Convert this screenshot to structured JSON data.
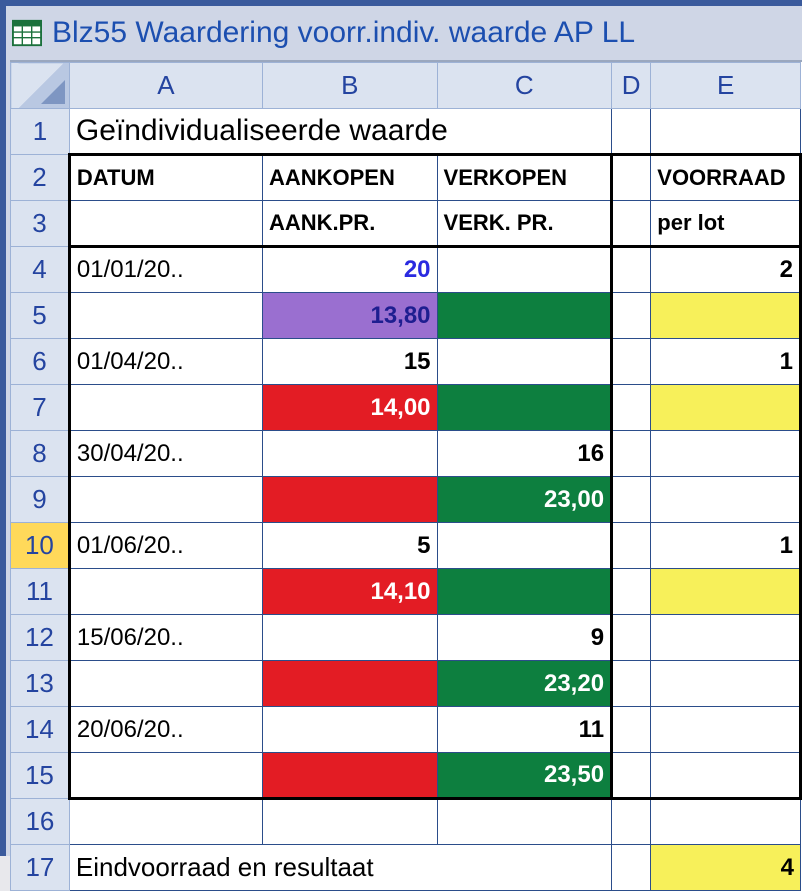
{
  "window": {
    "title": "Blz55 Waardering voorr.indiv. waarde AP LL"
  },
  "columns": [
    "A",
    "B",
    "C",
    "D",
    "E"
  ],
  "rowNumbers": [
    "1",
    "2",
    "3",
    "4",
    "5",
    "6",
    "7",
    "8",
    "9",
    "10",
    "11",
    "12",
    "13",
    "14",
    "15",
    "16",
    "17"
  ],
  "selectedRow": "10",
  "r1": {
    "title": "Geïndividualiseerde waarde"
  },
  "r2": {
    "a": "DATUM",
    "b": "AANKOPEN",
    "c": "VERKOPEN",
    "e": "VOORRAAD"
  },
  "r3": {
    "b": "AANK.PR.",
    "c": "VERK. PR.",
    "e": "per lot"
  },
  "r4": {
    "a": "01/01/20..",
    "b": "20",
    "e": "2"
  },
  "r5": {
    "b": "13,80"
  },
  "r6": {
    "a": "01/04/20..",
    "b": "15",
    "e": "1"
  },
  "r7": {
    "b": "14,00"
  },
  "r8": {
    "a": "30/04/20..",
    "c": "16"
  },
  "r9": {
    "c": "23,00"
  },
  "r10": {
    "a": "01/06/20..",
    "b": "5",
    "e": "1"
  },
  "r11": {
    "b": "14,10"
  },
  "r12": {
    "a": "15/06/20..",
    "c": "9"
  },
  "r13": {
    "c": "23,20"
  },
  "r14": {
    "a": "20/06/20..",
    "c": "11"
  },
  "r15": {
    "c": "23,50"
  },
  "r17": {
    "label": "Eindvoorraad en resultaat",
    "e": "4"
  }
}
